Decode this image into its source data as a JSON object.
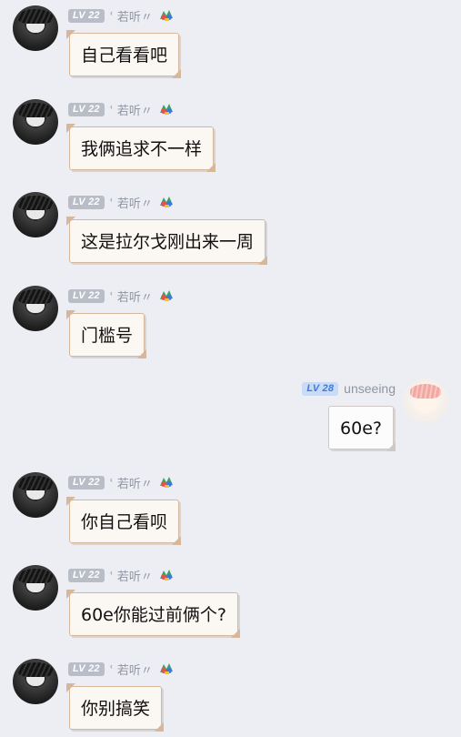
{
  "messages": [
    {
      "side": "left",
      "level": "LV 22",
      "name": "ʿ 若听〃",
      "text": "自己看看吧"
    },
    {
      "side": "left",
      "level": "LV 22",
      "name": "ʿ 若听〃",
      "text": "我俩追求不一样"
    },
    {
      "side": "left",
      "level": "LV 22",
      "name": "ʿ 若听〃",
      "text": "这是拉尔戈刚出来一周"
    },
    {
      "side": "left",
      "level": "LV 22",
      "name": "ʿ 若听〃",
      "text": "门槛号"
    },
    {
      "side": "right",
      "level": "LV 28",
      "name": "unseeing",
      "text": "60e?"
    },
    {
      "side": "left",
      "level": "LV 22",
      "name": "ʿ 若听〃",
      "text": "你自己看呗"
    },
    {
      "side": "left",
      "level": "LV 22",
      "name": "ʿ 若听〃",
      "text": "60e你能过前俩个?"
    },
    {
      "side": "left",
      "level": "LV 22",
      "name": "ʿ 若听〃",
      "text": "你别搞笑"
    }
  ],
  "icons": {
    "sender_tag_icon": "colorful-badge-icon",
    "avatar_left": "avatar-dark-anime",
    "avatar_right": "avatar-pink-anime"
  },
  "colors": {
    "background": "#eceef3",
    "bubble_border": "#d6b79c",
    "level_badge_gray": "#b9bdc8",
    "level_badge_blue": "#3b7be0"
  }
}
